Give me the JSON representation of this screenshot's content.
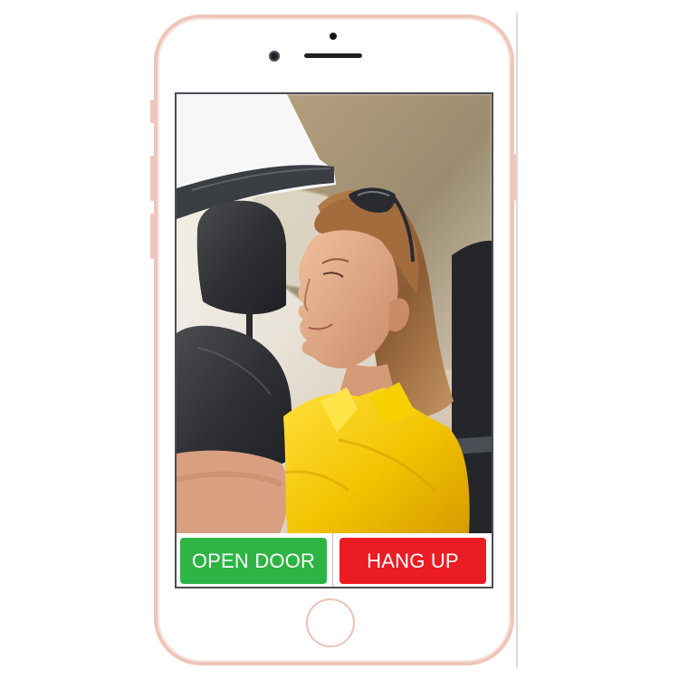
{
  "device": {
    "frame_color": "#efc5bb",
    "screen_bezel_color": "#494d55"
  },
  "call": {
    "open_door_label": "OPEN DOOR",
    "hang_up_label": "HANG UP",
    "open_door_color": "#2eb345",
    "hang_up_color": "#ec1c24"
  },
  "icons": {
    "front_camera": "camera-icon",
    "proximity_sensor": "sensor-icon",
    "speaker": "speaker-icon",
    "home": "home-button-icon"
  }
}
